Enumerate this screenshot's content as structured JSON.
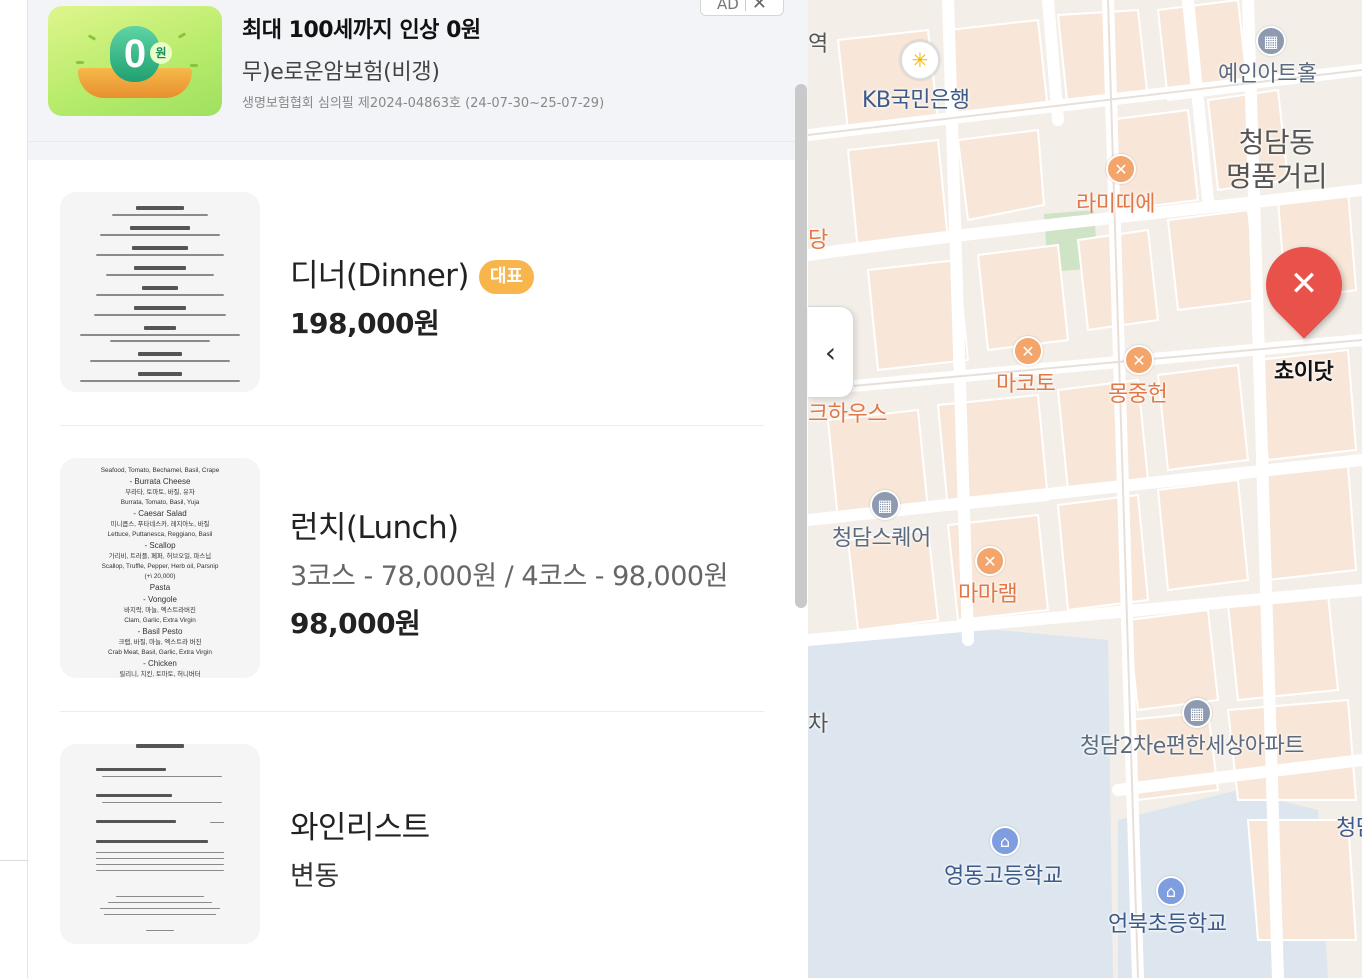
{
  "ad": {
    "label": "AD",
    "close": "✕",
    "title": "최대 100세까지 인상 0원",
    "subtitle": "무)e로운암보험(비갱)",
    "note": "생명보험협회 심의필 제2024-04863호 (24-07-30~25-07-29)",
    "thumb_digit": "0",
    "thumb_unit": "원"
  },
  "menu": {
    "items": [
      {
        "name": "디너(Dinner)",
        "badge": "대표",
        "desc": "",
        "price": "198,000원"
      },
      {
        "name": "런치(Lunch)",
        "badge": "",
        "desc": "3코스 - 78,000원 / 4코스 - 98,000원",
        "price": "98,000원"
      },
      {
        "name": "와인리스트",
        "badge": "",
        "desc": "",
        "price": "변동"
      }
    ]
  },
  "lunch_thumb_lines": [
    "Seafood, Tomato, Bechamel, Basil, Crape",
    "- Burrata Cheese",
    "부라타, 토마토, 바질, 유자",
    "Burrata, Tomato, Basil, Yuja",
    "- Caesar Salad",
    "미니콥스, 푸타네스카, 레지아노, 바질",
    "Lettuce, Puttanesca, Reggiano, Basil",
    "- Scallop",
    "가리비, 트러플, 페퍼, 허브오일, 파스닙",
    "Scallop, Truffle, Pepper, Herb oil, Parsnip",
    "(+\\ 20,000)",
    "Pasta",
    "- Vongole",
    "바지락, 마늘, 엑스트라버진",
    "Clam, Garlic, Extra Virgin",
    "- Basil Pesto",
    "크랩, 바질, 마늘, 엑스트라 버진",
    "Crab Meat, Basil, Garlic, Extra Virgin",
    "- Chicken",
    "릴리니, 치킨, 토마토, 허니버터"
  ],
  "map": {
    "toggle_icon": "‹",
    "labels": {
      "kb": "KB국민은행",
      "yein": "예인아트홀",
      "cheongdam_line1": "청담동",
      "cheongdam_line2": "명품거리",
      "lamidie": "라미띠에",
      "choidot": "쵸이닷",
      "makoto": "마코토",
      "mongjung": "몽중헌",
      "steakhouse": "크하우스",
      "square": "청담스퀘어",
      "mamalamb": "마마램",
      "apart": "청담2차e편한세상아파트",
      "youngdong": "영동고등학교",
      "eonbuk": "언북초등학교",
      "yeok": "역",
      "dang": "당",
      "cha": "차",
      "cheong": "청담"
    }
  },
  "icons": {
    "food": "fork-knife-icon",
    "building": "building-icon",
    "school": "school-icon",
    "bank": "bank-icon"
  }
}
